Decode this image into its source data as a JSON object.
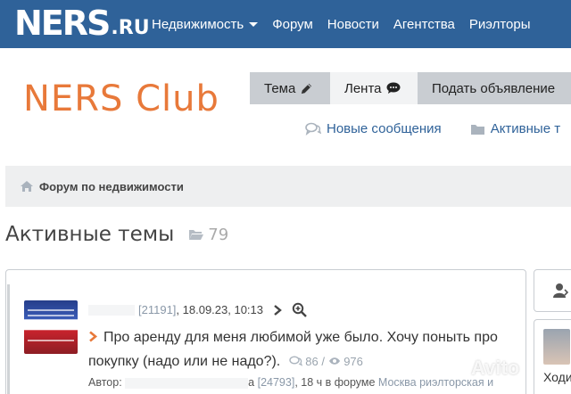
{
  "logo": {
    "main": "NERS",
    "suffix": ".RU"
  },
  "nav": [
    {
      "label": "Недвижимость",
      "dropdown": true
    },
    {
      "label": "Форум"
    },
    {
      "label": "Новости"
    },
    {
      "label": "Агентства"
    },
    {
      "label": "Риэлторы"
    }
  ],
  "club_title": "NERS Club",
  "tabs": {
    "topic": "Тема",
    "feed": "Лента",
    "post_ad": "Подать объявление"
  },
  "sublinks": {
    "new_messages": "Новые сообщения",
    "active": "Активные т"
  },
  "breadcrumb": {
    "label": "Форум по недвижимости"
  },
  "page": {
    "title": "Активные темы",
    "count": "79"
  },
  "thread": {
    "user_id": "[21191]",
    "date": ", 18.09.23, 10:13",
    "title": "Про аренду для меня любимой уже было. Хочу поныть про покупку (надо или не надо?).",
    "replies": "86",
    "views": "976",
    "author_label": "Автор:",
    "author_suffix": "а",
    "author_id": "[24793]",
    "ago": ", 18 ч в форуме",
    "forum": "Москва риэлторская и недвижимость Подмосковья"
  },
  "right": {
    "text": "Ходи"
  },
  "watermark": "Avito",
  "colors": {
    "nav_bg": "#2f6299",
    "accent": "#e8793a",
    "link": "#2f6299"
  }
}
